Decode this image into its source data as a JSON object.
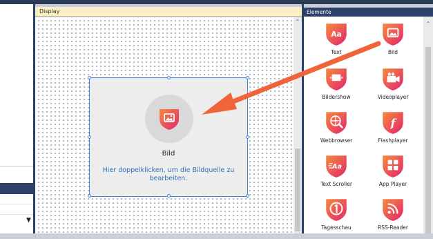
{
  "display_panel": {
    "title": "Display"
  },
  "widget": {
    "title": "Bild",
    "hint": "Hier doppelklicken, um die Bildquelle zu bearbeiten.",
    "icon": "image-icon"
  },
  "elements_panel": {
    "title": "Elemente",
    "items": [
      {
        "label": "Text",
        "icon": "text-icon"
      },
      {
        "label": "Bild",
        "icon": "image-icon"
      },
      {
        "label": "Bildershow",
        "icon": "slideshow-icon"
      },
      {
        "label": "Videoplayer",
        "icon": "video-camera-icon"
      },
      {
        "label": "Webbrowser",
        "icon": "web-browser-icon"
      },
      {
        "label": "Flashplayer",
        "icon": "flash-icon"
      },
      {
        "label": "Text Scroller",
        "icon": "text-scroller-icon"
      },
      {
        "label": "App Player",
        "icon": "app-player-icon"
      },
      {
        "label": "Tagesschau",
        "icon": "tagesschau-icon"
      },
      {
        "label": "RSS-Reader",
        "icon": "rss-icon"
      }
    ]
  },
  "colors": {
    "accent_orange": "#f26a3a",
    "accent_magenta": "#e3316d",
    "header_navy": "#2d4068",
    "display_header": "#fbf0c6",
    "selection_blue": "#3a86d8",
    "hint_blue": "#2f6fb7"
  }
}
